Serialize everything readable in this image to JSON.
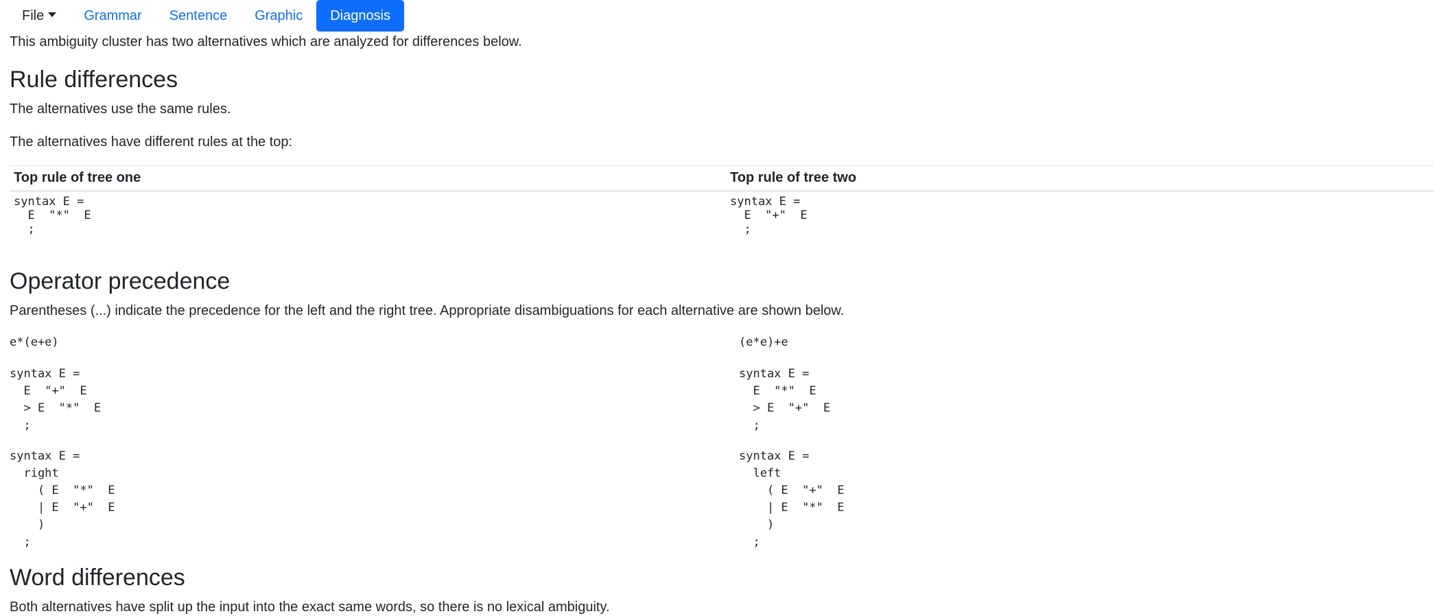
{
  "nav": {
    "file": "File",
    "tabs": [
      {
        "label": "Grammar"
      },
      {
        "label": "Sentence"
      },
      {
        "label": "Graphic"
      },
      {
        "label": "Diagnosis"
      }
    ]
  },
  "intro": "This ambiguity cluster has two alternatives which are analyzed for differences below.",
  "rules": {
    "heading": "Rule differences",
    "same_rules": "The alternatives use the same rules.",
    "different_top": "The alternatives have different rules at the top:",
    "col1_header": "Top rule of tree one",
    "col2_header": "Top rule of tree two",
    "tree_one": "syntax E =\n  E  \"*\"  E\n  ;",
    "tree_two": "syntax E =\n  E  \"+\"  E\n  ;"
  },
  "precedence": {
    "heading": "Operator precedence",
    "desc": "Parentheses (...) indicate the precedence for the left and the right tree. Appropriate disambiguations for each alternative are shown below.",
    "left_expr": "e*(e+e)",
    "left_priority": "syntax E =\n  E  \"+\"  E\n  > E  \"*\"  E\n  ;",
    "left_assoc": "syntax E =\n  right\n    ( E  \"*\"  E\n    | E  \"+\"  E\n    )\n  ;",
    "right_expr": "(e*e)+e",
    "right_priority": "syntax E =\n  E  \"*\"  E\n  > E  \"+\"  E\n  ;",
    "right_assoc": "syntax E =\n  left\n    ( E  \"+\"  E\n    | E  \"*\"  E\n    )\n  ;"
  },
  "words": {
    "heading": "Word differences",
    "desc": "Both alternatives have split up the input into the exact same words, so there is no lexical ambiguity."
  }
}
